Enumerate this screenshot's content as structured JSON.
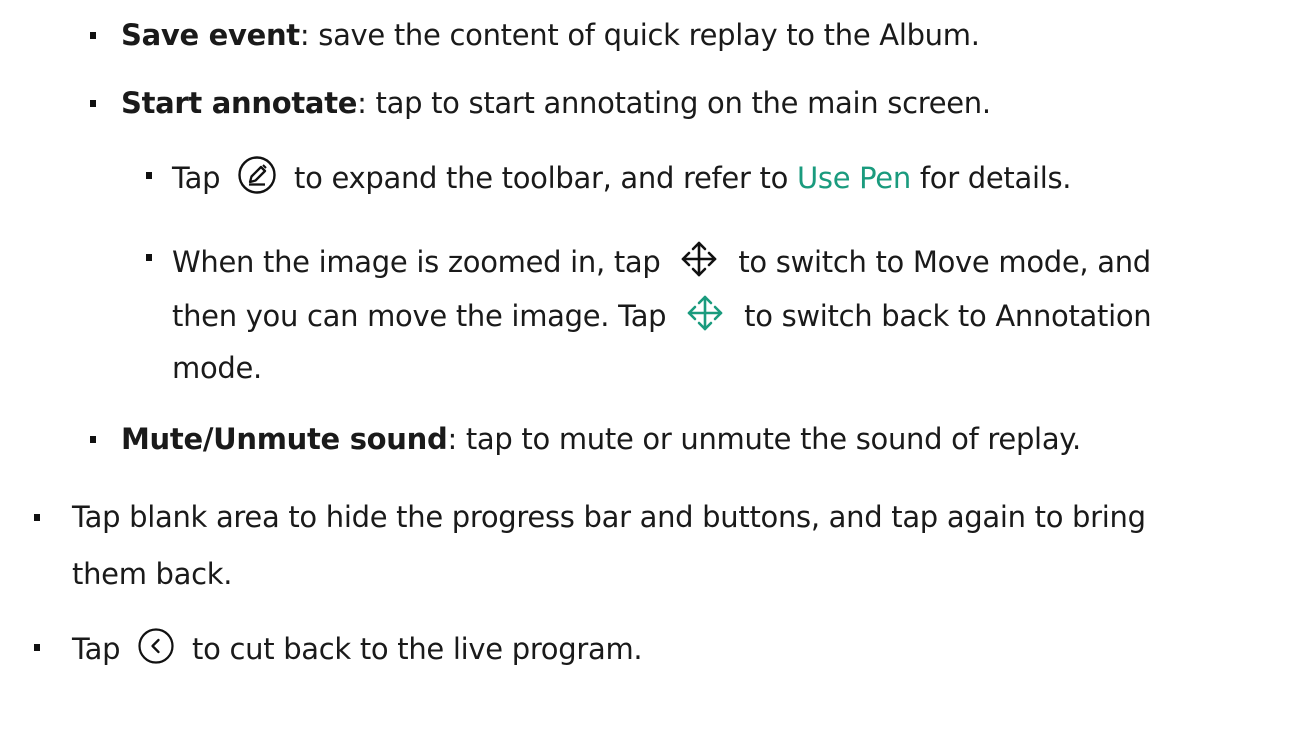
{
  "items": {
    "save_event": {
      "term": "Save event",
      "text": ": save the content of quick replay to the Album."
    },
    "start_annotate": {
      "term": "Start annotate",
      "text": ": tap to start annotating on the main screen."
    },
    "pen_tip": {
      "tap": "Tap",
      "text_before_link": "to expand the toolbar, and refer to",
      "link": "Use Pen",
      "text_after_link": "for details.",
      "icon": "pen-circle-icon"
    },
    "move_tip": {
      "line1_before": "When the image is zoomed in, tap",
      "line1_after": "to switch to Move mode, and",
      "line2_before": "then you can move the image. Tap",
      "line2_after": "to switch back to Annotation",
      "line3": "mode.",
      "icon_black": "move-arrows-icon",
      "icon_green": "move-arrows-green-icon"
    },
    "mute": {
      "term": "Mute/Unmute sound",
      "text": ": tap to mute or unmute the sound of replay."
    },
    "blank_area": {
      "line1": "Tap blank area to hide the progress bar and buttons, and tap again to bring",
      "line2": "them back."
    },
    "back": {
      "tap": "Tap",
      "text": "to cut back to the live program.",
      "icon": "back-circle-icon"
    }
  },
  "colors": {
    "text": "#1a1a1a",
    "link": "#1a9b7e",
    "move_green": "#1a9b7e"
  }
}
